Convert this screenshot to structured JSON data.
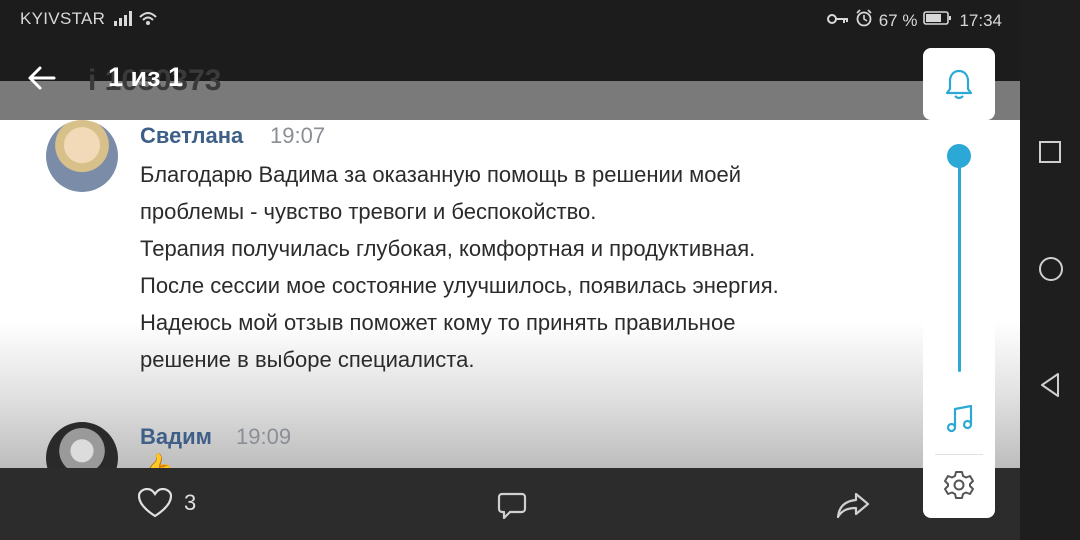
{
  "status_bar": {
    "carrier": "KYIVSTAR",
    "battery": "67 %",
    "clock": "17:34"
  },
  "header": {
    "counter": "1 из 1",
    "ghost_title": "i 1050373"
  },
  "comments": [
    {
      "author": "Светлана",
      "time": "19:07",
      "lines": [
        "Благодарю Вадима за оказанную помощь в решении моей",
        "проблемы - чувство тревоги и беспокойство.",
        "Терапия получилась глубокая, комфортная и продуктивная.",
        "После сессии мое состояние улучшилось, появилась энергия.",
        "Надеюсь мой отзыв поможет кому то принять правильное",
        "решение в выборе специалиста."
      ]
    },
    {
      "author": "Вадим",
      "time": "19:09",
      "content": "👍"
    }
  ],
  "footer": {
    "likes": "3"
  },
  "volume_panel": {
    "level": 1.0,
    "accent": "#2ba8d6"
  },
  "icons": {
    "back": "arrow-left-icon",
    "bell": "bell-icon",
    "music": "music-note-icon",
    "settings": "gear-icon",
    "like": "heart-icon",
    "comment": "comment-icon",
    "share": "share-icon"
  }
}
